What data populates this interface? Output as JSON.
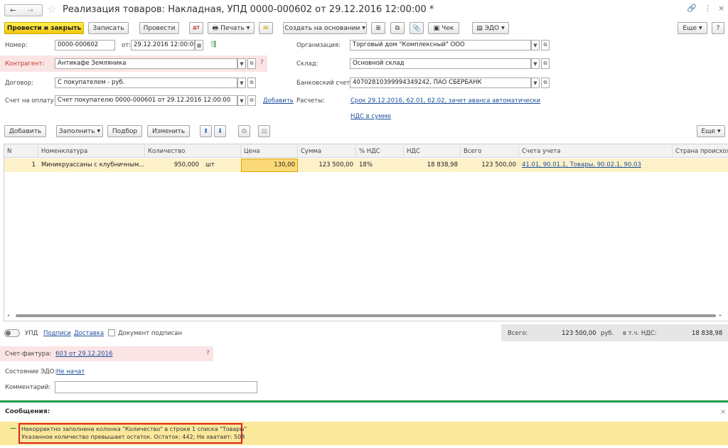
{
  "window": {
    "title": "Реализация товаров: Накладная, УПД 0000-000602 от 29.12.2016 12:00:00 *"
  },
  "toolbar": {
    "post_close": "Провести и закрыть",
    "save": "Записать",
    "post": "Провести",
    "print": "Печать",
    "create_based": "Создать на основании",
    "check": "Чек",
    "edo": "ЭДО",
    "more": "Еще",
    "help": "?"
  },
  "form": {
    "number_label": "Номер:",
    "number_value": "0000-000602",
    "date_label": "от:",
    "date_value": "29.12.2016 12:00:00",
    "org_label": "Организация:",
    "org_value": "Торговый дом \"Комплексный\" ООО",
    "counterparty_label": "Контрагент:",
    "counterparty_value": "Антикафе Земляника",
    "warehouse_label": "Склад:",
    "warehouse_value": "Основной склад",
    "contract_label": "Договор:",
    "contract_value": "С покупателем - руб.",
    "bank_label": "Банковский счет:",
    "bank_value": "40702810399994349242, ПАО СБЕРБАНК",
    "invoice_label": "Счет на оплату:",
    "invoice_value": "Счет покупателю 0000-000601 от 29.12.2016 12:00:00",
    "add_link": "Добавить",
    "settlements_label": "Расчеты:",
    "settlements_link": "Срок 29.12.2016, 62.01, 62.02, зачет аванса автоматически",
    "vat_link": "НДС в сумме"
  },
  "table_toolbar": {
    "add": "Добавить",
    "fill": "Заполнить",
    "select": "Подбор",
    "change": "Изменить",
    "more": "Еще"
  },
  "table": {
    "headers": {
      "n": "N",
      "item": "Номенклатура",
      "qty": "Количество",
      "price": "Цена",
      "sum": "Сумма",
      "vat_rate": "% НДС",
      "vat": "НДС",
      "total": "Всего",
      "accounts": "Счета учета",
      "country": "Страна происхождения"
    },
    "rows": [
      {
        "n": "1",
        "item": "Миникруассаны с клубничным...",
        "qty": "950,000",
        "unit": "шт",
        "price": "130,00",
        "sum": "123 500,00",
        "vat_rate": "18%",
        "vat": "18 838,98",
        "total": "123 500,00",
        "accounts": "41.01, 90.01.1, Товары, 90.02.1, 90.03"
      }
    ]
  },
  "footer": {
    "upd_label": "УПД",
    "signatures_link": "Подписи",
    "delivery_link": "Доставка",
    "signed_label": "Документ подписан",
    "total_label": "Всего:",
    "total_value": "123 500,00",
    "currency": "руб.",
    "vat_incl_label": "в т.ч. НДС:",
    "vat_incl_value": "18 838,98",
    "invoice_doc_label": "Счет-фактура:",
    "invoice_doc_link": "603 от 29.12.2016",
    "edo_state_label": "Состояние ЭДО:",
    "edo_state_link": "Не начат",
    "comment_label": "Комментарий:",
    "comment_value": ""
  },
  "messages": {
    "title": "Сообщения:",
    "line1": "Некорректно заполнена колонка \"Количество\" в строке 1 списка \"Товары\"",
    "line2": "Указанное количество превышает остаток. Остаток: 442; Не хватает: 508"
  },
  "colors": {
    "accent": "#f2c40c",
    "highlight": "#fbe4e4",
    "selected_row": "#fdf1c9",
    "green_bar": "#1e9a4b"
  }
}
